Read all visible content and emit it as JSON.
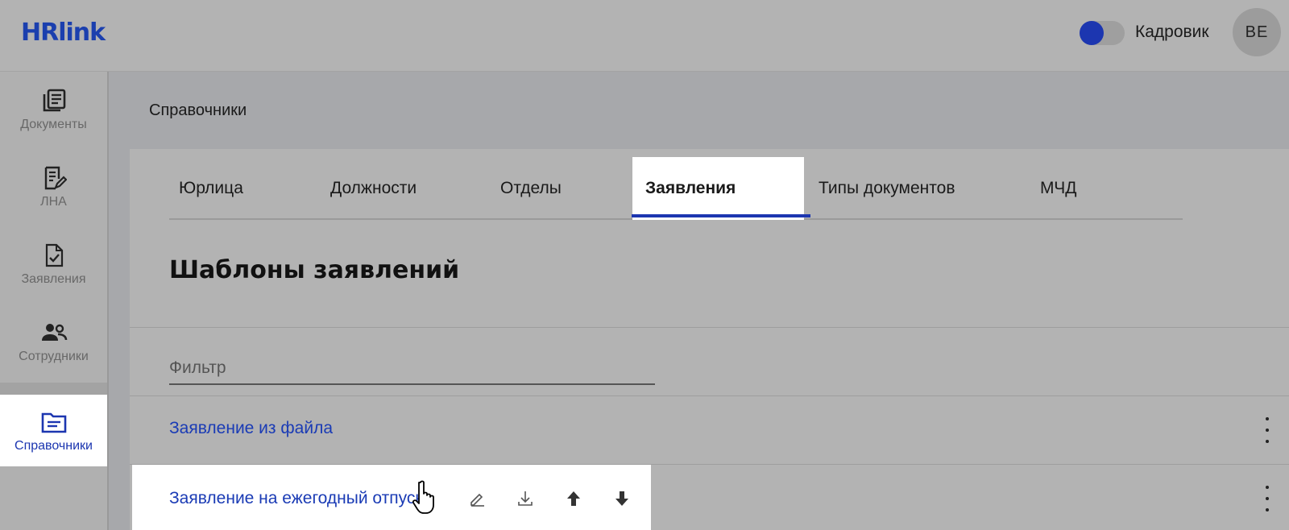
{
  "header": {
    "logo": "HRlink",
    "role_label": "Кадровик",
    "avatar_initials": "BE",
    "toggle_on": true
  },
  "sidebar": {
    "items": [
      {
        "label": "Документы",
        "icon": "documents-icon"
      },
      {
        "label": "ЛНА",
        "icon": "lna-edit-icon"
      },
      {
        "label": "Заявления",
        "icon": "application-check-icon"
      },
      {
        "label": "Сотрудники",
        "icon": "employees-icon"
      },
      {
        "label": "Справочники",
        "icon": "folder-icon",
        "active": true
      }
    ]
  },
  "breadcrumb": "Справочники",
  "tabs": [
    {
      "label": "Юрлица"
    },
    {
      "label": "Должности"
    },
    {
      "label": "Отделы"
    },
    {
      "label": "Заявления",
      "active": true
    },
    {
      "label": "Типы документов"
    },
    {
      "label": "МЧД"
    }
  ],
  "section_title": "Шаблоны заявлений",
  "filter": {
    "placeholder": "Фильтр",
    "value": ""
  },
  "templates": [
    {
      "name": "Заявление из файла"
    },
    {
      "name": "Заявление на ежегодный отпуск"
    }
  ],
  "row_actions": [
    "edit-icon",
    "download-icon",
    "move-up-icon",
    "move-down-icon"
  ],
  "colors": {
    "accent": "#1c36b0",
    "link": "#1a3bb5"
  }
}
